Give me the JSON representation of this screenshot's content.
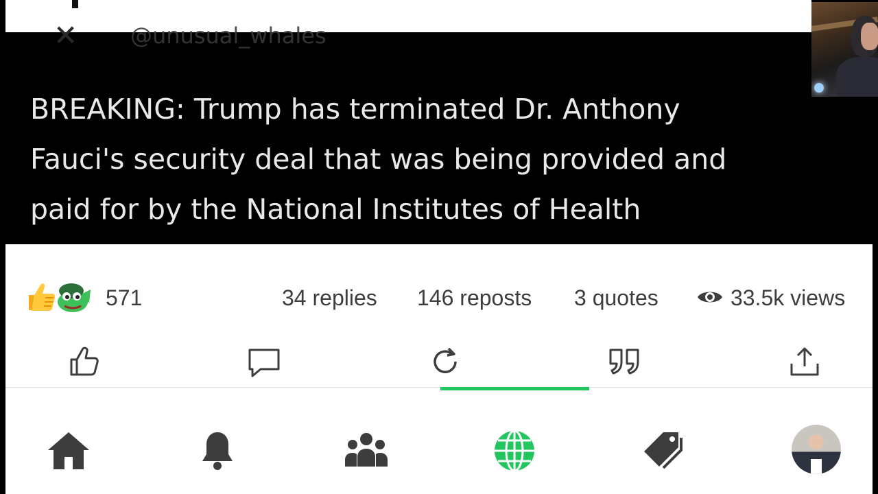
{
  "tweet": {
    "handle": "@unusual_whales",
    "lines": [
      "BREAKING: Trump has terminated Dr. Anthony",
      "Fauci's security deal that was being provided and",
      "paid for by the National Institutes of Health"
    ]
  },
  "stats": {
    "reactions_count": "571",
    "replies": "34 replies",
    "reposts": "146 reposts",
    "quotes": "3 quotes",
    "views": "33.5k views"
  },
  "actions": [
    "like-icon",
    "reply-icon",
    "repost-icon",
    "quote-icon",
    "share-icon"
  ],
  "active_action": "repost",
  "nav": [
    "home-icon",
    "bell-icon",
    "people-icon",
    "globe-icon",
    "tags-icon",
    "avatar"
  ],
  "active_nav": "globe",
  "colors": {
    "accent": "#22c55e",
    "icon": "#3d3d3d",
    "tweet_bg": "#000000",
    "tweet_text": "#e7e9ea"
  }
}
